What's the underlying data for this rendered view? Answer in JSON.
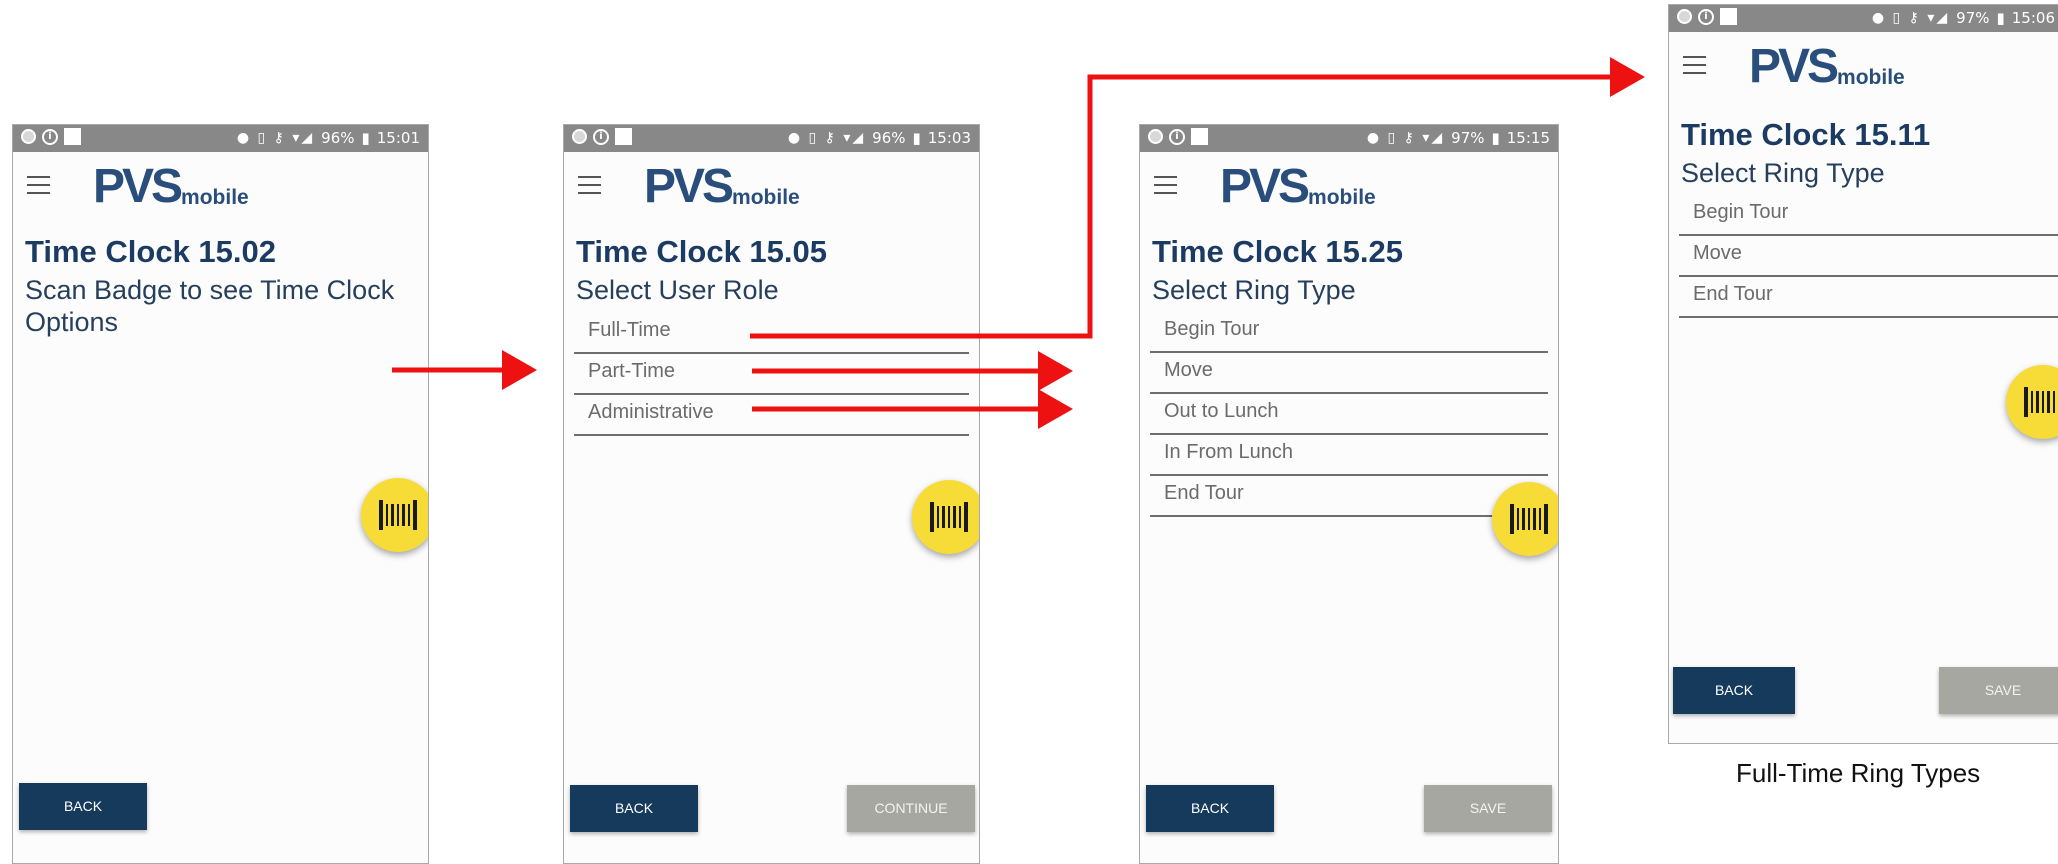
{
  "brand": {
    "pvs": "PVS",
    "mobile": "mobile"
  },
  "screens": [
    {
      "status": {
        "battery": "96%",
        "time": "15:01"
      },
      "title": "Time Clock 15.02",
      "subtitle": "Scan Badge to see Time Clock Options",
      "items": [],
      "back_label": "BACK",
      "action_label": ""
    },
    {
      "status": {
        "battery": "96%",
        "time": "15:03"
      },
      "title": "Time Clock 15.05",
      "subtitle": "Select User Role",
      "items": [
        "Full-Time",
        "Part-Time",
        "Administrative"
      ],
      "back_label": "BACK",
      "action_label": "CONTINUE"
    },
    {
      "status": {
        "battery": "97%",
        "time": "15:15"
      },
      "title": "Time Clock 15.25",
      "subtitle": "Select Ring Type",
      "items": [
        "Begin Tour",
        "Move",
        "Out to Lunch",
        "In From Lunch",
        "End Tour"
      ],
      "back_label": "BACK",
      "action_label": "SAVE"
    },
    {
      "status": {
        "battery": "97%",
        "time": "15:06"
      },
      "title": "Time Clock 15.11",
      "subtitle": "Select Ring Type",
      "items": [
        "Begin Tour",
        "Move",
        "End Tour"
      ],
      "back_label": "BACK",
      "action_label": "SAVE"
    }
  ],
  "caption": "Full-Time Ring Types",
  "colors": {
    "title": "#1c3b62",
    "brand": "#2a4e7c",
    "back_button": "#153a5c",
    "disabled_button": "#a7a7a2",
    "scan_fab": "#f7dc38",
    "arrow": "#ee1111",
    "status_bar": "#888888"
  },
  "icons": {
    "menu": "hamburger-icon",
    "scan": "barcode-icon",
    "location": "location-pin-icon",
    "vibrate": "vibrate-icon",
    "vpn": "key-icon",
    "wifi": "wifi-icon",
    "signal": "signal-icon",
    "battery": "battery-icon"
  }
}
